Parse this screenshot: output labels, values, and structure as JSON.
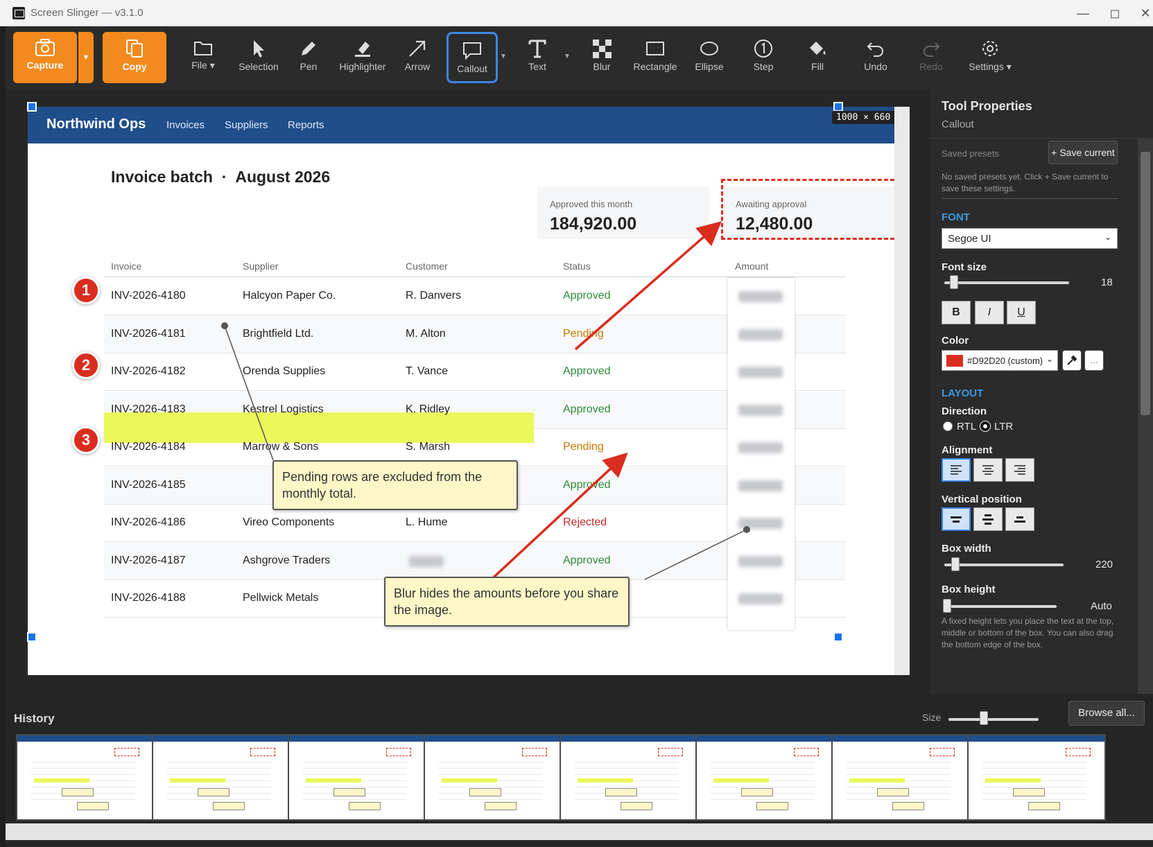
{
  "window": {
    "title": "Screen Slinger — v3.1.0"
  },
  "toolbar": {
    "capture": "Capture",
    "copy": "Copy",
    "file": "File",
    "selection": "Selection",
    "pen": "Pen",
    "highlighter": "Highlighter",
    "arrow": "Arrow",
    "callout": "Callout",
    "text": "Text",
    "blur": "Blur",
    "rectangle": "Rectangle",
    "ellipse": "Ellipse",
    "step": "Step",
    "fill": "Fill",
    "undo": "Undo",
    "redo": "Redo",
    "settings": "Settings",
    "accent_color": "#f28a1d",
    "active_tool": "Callout"
  },
  "canvas": {
    "dimensions": "1000 × 660 px",
    "nav": {
      "brand": "Northwind Ops",
      "links": [
        "Invoices",
        "Suppliers",
        "Reports"
      ]
    },
    "title": "Invoice batch  ·  August 2026",
    "cards": [
      {
        "label": "Approved this month",
        "value": "184,920.00"
      },
      {
        "label": "Awaiting approval",
        "value": "12,480.00"
      }
    ],
    "columns": [
      "Invoice",
      "Supplier",
      "Customer",
      "Status",
      "Amount"
    ],
    "rows": [
      {
        "invoice": "INV-2026-4180",
        "supplier": "Halcyon Paper Co.",
        "customer": "R. Danvers",
        "status": "Approved"
      },
      {
        "invoice": "INV-2026-4181",
        "supplier": "Brightfield Ltd.",
        "customer": "M. Alton",
        "status": "Pending"
      },
      {
        "invoice": "INV-2026-4182",
        "supplier": "Orenda Supplies",
        "customer": "T. Vance",
        "status": "Approved"
      },
      {
        "invoice": "INV-2026-4183",
        "supplier": "Kestrel Logistics",
        "customer": "K. Ridley",
        "status": "Approved"
      },
      {
        "invoice": "INV-2026-4184",
        "supplier": "Marrow & Sons",
        "customer": "S. Marsh",
        "status": "Pending"
      },
      {
        "invoice": "INV-2026-4185",
        "supplier": "",
        "customer": "",
        "status": "Approved"
      },
      {
        "invoice": "INV-2026-4186",
        "supplier": "Vireo Components",
        "customer": "L. Hume",
        "status": "Rejected"
      },
      {
        "invoice": "INV-2026-4187",
        "supplier": "Ashgrove Traders",
        "customer": "",
        "status": "Approved"
      },
      {
        "invoice": "INV-2026-4188",
        "supplier": "Pellwick Metals",
        "customer": "",
        "status": ""
      }
    ],
    "steps": [
      "1",
      "2",
      "3"
    ],
    "callouts": [
      "Pending rows are excluded from the monthly total.",
      "Blur hides the amounts before you share the image."
    ]
  },
  "panel": {
    "title": "Tool Properties",
    "subtitle": "Callout",
    "saved_presets_label": "Saved presets",
    "save_current": "+ Save current",
    "no_presets_note": "No saved presets yet. Click + Save current to save these settings.",
    "font_section": "FONT",
    "font_value": "Segoe UI",
    "font_size_label": "Font size",
    "font_size": "18",
    "bold": "B",
    "italic": "I",
    "underline": "U",
    "color_label": "Color",
    "color_value": "#D92D20 (custom)",
    "color_hex": "#D92D20",
    "more": "...",
    "layout_section": "LAYOUT",
    "direction_label": "Direction",
    "rtl": "RTL",
    "ltr": "LTR",
    "alignment_label": "Alignment",
    "vertical_label": "Vertical position",
    "box_width_label": "Box width",
    "box_width": "220",
    "box_height_label": "Box height",
    "box_height": "Auto",
    "height_note": "A fixed height lets you place the text at the top, middle or bottom of the box. You can also drag the bottom edge of the box."
  },
  "history": {
    "title": "History",
    "size_label": "Size",
    "browse": "Browse all...",
    "thumbnail_count": 8
  }
}
